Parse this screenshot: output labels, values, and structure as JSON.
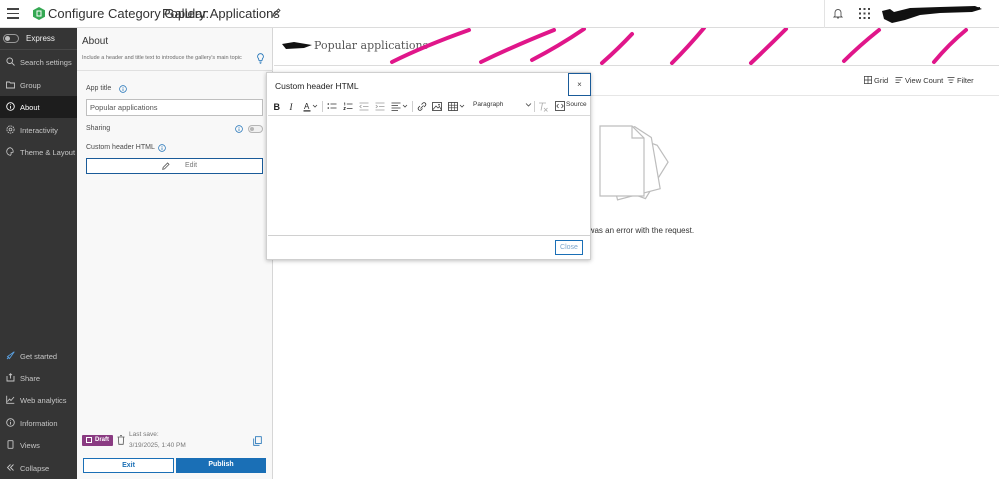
{
  "header": {
    "title": "Configure Category Gallery:",
    "app_name": "Popular Applications",
    "brand_color": "#35a853"
  },
  "rail": {
    "express_label": "Express",
    "items": [
      {
        "label": "Search settings",
        "icon": "search-icon"
      },
      {
        "label": "Group",
        "icon": "folder-icon"
      },
      {
        "label": "About",
        "icon": "info-icon",
        "active": true
      },
      {
        "label": "Interactivity",
        "icon": "gear-icon"
      },
      {
        "label": "Theme & Layout",
        "icon": "palette-icon"
      }
    ],
    "bottom_items": [
      {
        "label": "Get started",
        "icon": "rocket-icon"
      },
      {
        "label": "Share",
        "icon": "share-icon"
      },
      {
        "label": "Web analytics",
        "icon": "chart-icon"
      },
      {
        "label": "Information",
        "icon": "info-icon"
      },
      {
        "label": "Views",
        "icon": "device-icon"
      },
      {
        "label": "Collapse",
        "icon": "chevron-double-left-icon"
      }
    ]
  },
  "panel": {
    "title": "About",
    "description": "Include a header and title text to introduce the gallery's main topic",
    "app_title_label": "App title",
    "app_title_value": "Popular applications",
    "sharing_label": "Sharing",
    "custom_header_label": "Custom header HTML",
    "edit_label": "Edit",
    "draft_label": "Draft",
    "last_save_label": "Last save:",
    "last_save_value": "3/19/2025, 1:40 PM",
    "exit_label": "Exit",
    "publish_label": "Publish"
  },
  "preview": {
    "banner_title": "Popular applications",
    "grid_label": "Grid",
    "view_count_label": "View Count",
    "filter_label": "Filter",
    "error_text": "e was an error with the request."
  },
  "modal": {
    "title": "Custom header HTML",
    "close_x": "×",
    "paragraph_label": "Paragraph",
    "source_label": "Source",
    "close_label": "Close"
  }
}
